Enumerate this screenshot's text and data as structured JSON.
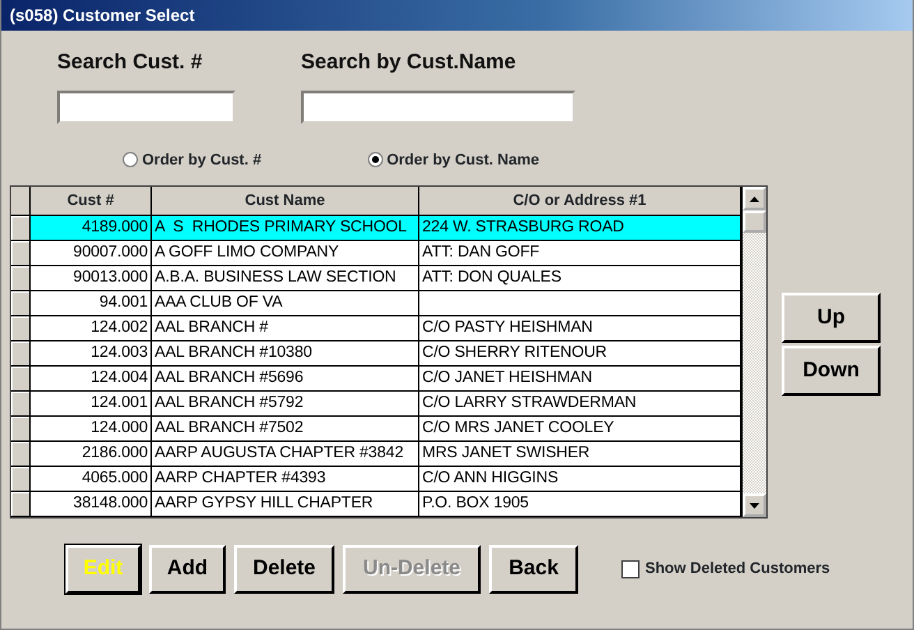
{
  "window": {
    "title": "(s058) Customer Select"
  },
  "search_fields": [
    {
      "label": "Search Cust. #"
    },
    {
      "label": "Search by Cust.Name"
    }
  ],
  "order_options": [
    {
      "label": "Order by Cust. #",
      "selected": false
    },
    {
      "label": "Order by Cust. Name",
      "selected": true
    }
  ],
  "table": {
    "columns": [
      "Cust #",
      "Cust Name",
      "C/O or Address #1"
    ],
    "rows": [
      {
        "cells": [
          "4189.000",
          "A  S  RHODES PRIMARY SCHOOL",
          "224 W. STRASBURG ROAD"
        ],
        "selected": true
      },
      {
        "cells": [
          "90007.000",
          "A GOFF LIMO COMPANY",
          "ATT: DAN GOFF"
        ],
        "selected": false
      },
      {
        "cells": [
          "90013.000",
          "A.B.A. BUSINESS LAW SECTION",
          "ATT: DON QUALES"
        ],
        "selected": false
      },
      {
        "cells": [
          "94.001",
          "AAA CLUB OF VA",
          ""
        ],
        "selected": false
      },
      {
        "cells": [
          "124.002",
          "AAL BRANCH #",
          "C/O PASTY HEISHMAN"
        ],
        "selected": false
      },
      {
        "cells": [
          "124.003",
          "AAL BRANCH #10380",
          "C/O SHERRY RITENOUR"
        ],
        "selected": false
      },
      {
        "cells": [
          "124.004",
          "AAL BRANCH #5696",
          "C/O JANET HEISHMAN"
        ],
        "selected": false
      },
      {
        "cells": [
          "124.001",
          "AAL BRANCH #5792",
          "C/O LARRY STRAWDERMAN"
        ],
        "selected": false
      },
      {
        "cells": [
          "124.000",
          "AAL BRANCH #7502",
          "C/O MRS JANET COOLEY"
        ],
        "selected": false
      },
      {
        "cells": [
          "2186.000",
          "AARP AUGUSTA CHAPTER #3842",
          "MRS JANET SWISHER"
        ],
        "selected": false
      },
      {
        "cells": [
          "4065.000",
          "AARP CHAPTER #4393",
          "C/O ANN HIGGINS"
        ],
        "selected": false
      },
      {
        "cells": [
          "38148.000",
          "AARP GYPSY HILL CHAPTER",
          "P.O. BOX 1905"
        ],
        "selected": false
      }
    ]
  },
  "side_buttons": [
    {
      "label": "Up"
    },
    {
      "label": "Down"
    }
  ],
  "buttons": [
    {
      "label": "Edit",
      "focused": true,
      "disabled": false
    },
    {
      "label": "Add",
      "focused": false,
      "disabled": false
    },
    {
      "label": "Delete",
      "focused": false,
      "disabled": false
    },
    {
      "label": "Un-Delete",
      "focused": false,
      "disabled": true
    },
    {
      "label": "Back",
      "focused": false,
      "disabled": false
    }
  ],
  "show_deleted": {
    "label": "Show Deleted Customers",
    "checked": false
  }
}
